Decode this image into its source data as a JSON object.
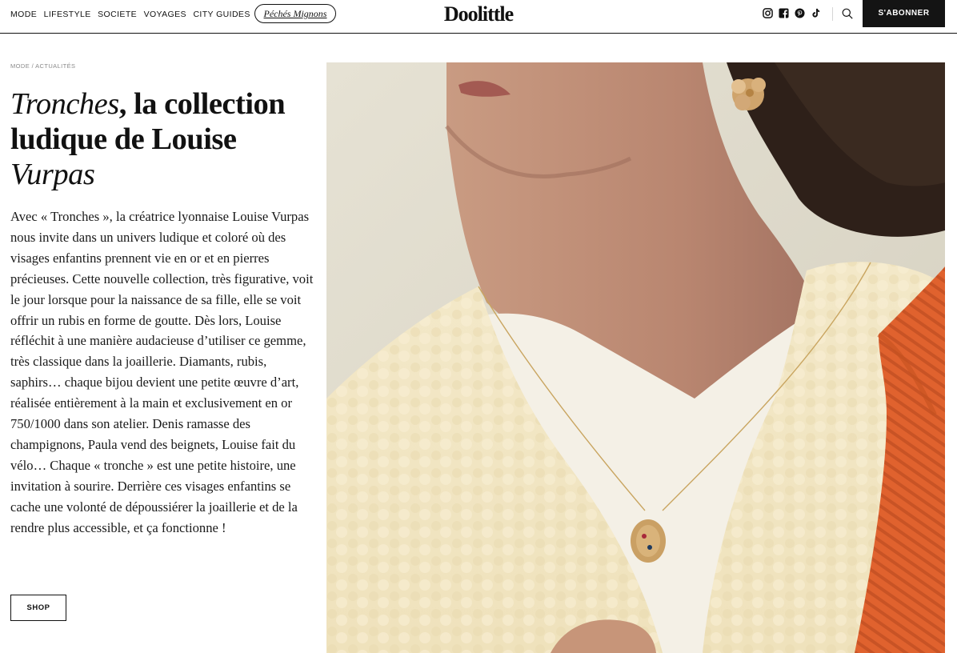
{
  "nav": {
    "items": [
      "MODE",
      "LIFESTYLE",
      "SOCIETE",
      "VOYAGES",
      "CITY GUIDES"
    ],
    "special_link": "Péchés Mignons"
  },
  "logo": {
    "text": "Doolittle"
  },
  "socials": [
    "instagram-icon",
    "facebook-icon",
    "pinterest-icon",
    "tiktok-icon"
  ],
  "header": {
    "subscribe_label": "S'ABONNER",
    "search_icon": "search-icon"
  },
  "article": {
    "breadcrumb": "MODE / ACTUALITÉS",
    "title_italic_1": "Tronches",
    "title_mid": ", la collection ludique de Louise ",
    "title_italic_2": "Vurpas",
    "body": "Avec « Tronches », la créatrice lyonnaise Louise Vurpas nous invite dans un univers ludique et coloré où des visages enfantins prennent vie en or et en pierres précieuses. Cette nouvelle collection, très figurative, voit le jour lorsque pour la naissance de sa fille, elle se voit offrir un rubis en forme de goutte. Dès lors, Louise réfléchit à une manière audacieuse d’utiliser ce gemme, très classique dans la joaillerie. Diamants, rubis, saphirs… chaque bijou devient une petite œuvre d’art, réalisée entièrement à la main et exclusivement en or 750/1000 dans son atelier. Denis ramasse des champignons, Paula vend des beignets, Louise fait du vélo… Chaque « tronche » est une petite histoire, une invitation à sourire. Derrière ces visages enfantins se cache une volonté de dépoussiérer la joaillerie et de la rendre plus accessible, et ça fonctionne !",
    "shop_label": "SHOP"
  },
  "colors": {
    "ink": "#111111",
    "button_dark": "#141414",
    "background": "#ffffff",
    "crumb": "#8a8a8a"
  }
}
